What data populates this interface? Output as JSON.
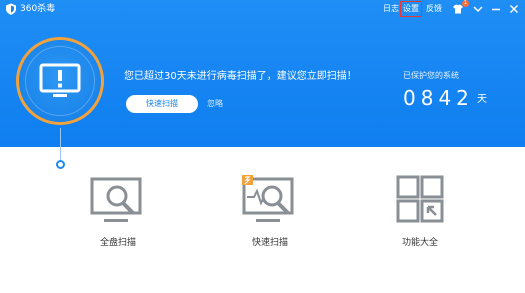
{
  "titlebar": {
    "app_title": "360杀毒",
    "links": {
      "log": "日志",
      "settings": "设置",
      "feedback": "反馈"
    },
    "badge_count": "1",
    "icons": [
      "shirt-icon",
      "dropdown-icon",
      "minimize-icon",
      "close-icon"
    ]
  },
  "hero": {
    "warning": "您已超过30天未进行病毒扫描了，建议您立即扫描！",
    "quick_scan_button": "快速扫描",
    "ignore_link": "忽略",
    "protected_label": "已保护您的系统",
    "protected_days": "0842",
    "protected_days_unit": "天"
  },
  "tools": [
    {
      "label": "全盘扫描",
      "icon": "full-scan-icon"
    },
    {
      "label": "快速扫描",
      "icon": "quick-scan-icon"
    },
    {
      "label": "功能大全",
      "icon": "all-functions-icon"
    }
  ],
  "colors": {
    "header_blue": "#1a84ea",
    "ring_orange": "#f2a23c",
    "settings_highlight": "#e53935",
    "icon_gray": "#8a8f96"
  }
}
